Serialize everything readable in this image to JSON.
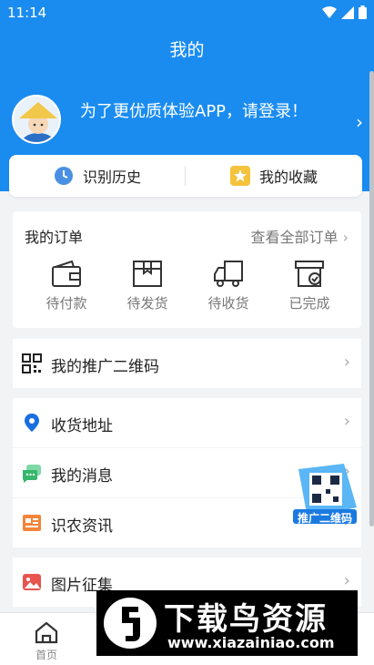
{
  "status_bar": {
    "time": "11:14"
  },
  "header": {
    "title": "我的"
  },
  "profile": {
    "login_prompt": "为了更优质体验APP，请登录！"
  },
  "quick_links": [
    {
      "label": "识别历史",
      "icon": "clock-icon"
    },
    {
      "label": "我的收藏",
      "icon": "star-icon"
    }
  ],
  "orders": {
    "title": "我的订单",
    "view_all": "查看全部订单",
    "items": [
      {
        "label": "待付款",
        "icon": "wallet-icon"
      },
      {
        "label": "待发货",
        "icon": "package-icon"
      },
      {
        "label": "待收货",
        "icon": "truck-icon"
      },
      {
        "label": "已完成",
        "icon": "completed-box-icon"
      }
    ]
  },
  "menu": {
    "qrcode": "我的推广二维码",
    "address": "收货地址",
    "messages": "我的消息",
    "news": "识农资讯",
    "photos": "图片征集"
  },
  "promo_badge": {
    "text": "推广二维码"
  },
  "bottom_nav": {
    "home": "首页"
  },
  "watermark": {
    "title": "下载鸟资源",
    "url": "www.xiazainiao.com"
  },
  "colors": {
    "primary": "#1a8cf0",
    "background": "#f2f3f5"
  }
}
